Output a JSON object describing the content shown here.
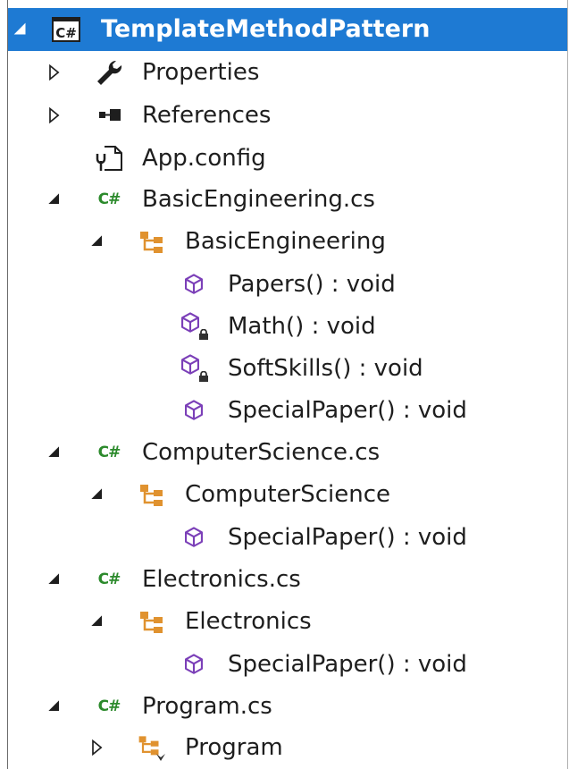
{
  "tree": {
    "project": {
      "label": "TemplateMethodPattern",
      "icon": "csharp-project-icon"
    },
    "properties": {
      "label": "Properties",
      "icon": "wrench-icon"
    },
    "references": {
      "label": "References",
      "icon": "references-icon"
    },
    "app_config": {
      "label": "App.config",
      "icon": "config-file-icon"
    },
    "files": [
      {
        "label": "BasicEngineering.cs",
        "class": {
          "label": "BasicEngineering",
          "members": [
            {
              "label": "Papers() : void",
              "protected": false
            },
            {
              "label": "Math() : void",
              "protected": true
            },
            {
              "label": "SoftSkills() : void",
              "protected": true
            },
            {
              "label": "SpecialPaper() : void",
              "protected": false
            }
          ]
        }
      },
      {
        "label": "ComputerScience.cs",
        "class": {
          "label": "ComputerScience",
          "members": [
            {
              "label": "SpecialPaper() : void",
              "protected": false
            }
          ]
        }
      },
      {
        "label": "Electronics.cs",
        "class": {
          "label": "Electronics",
          "members": [
            {
              "label": "SpecialPaper() : void",
              "protected": false
            }
          ]
        }
      },
      {
        "label": "Program.cs",
        "class": {
          "label": "Program",
          "members": []
        }
      }
    ]
  },
  "colors": {
    "selection": "#1e7ad3",
    "class_icon": "#e0922f",
    "method_icon": "#7b3fb8",
    "csharp_green": "#2c8a2c"
  }
}
